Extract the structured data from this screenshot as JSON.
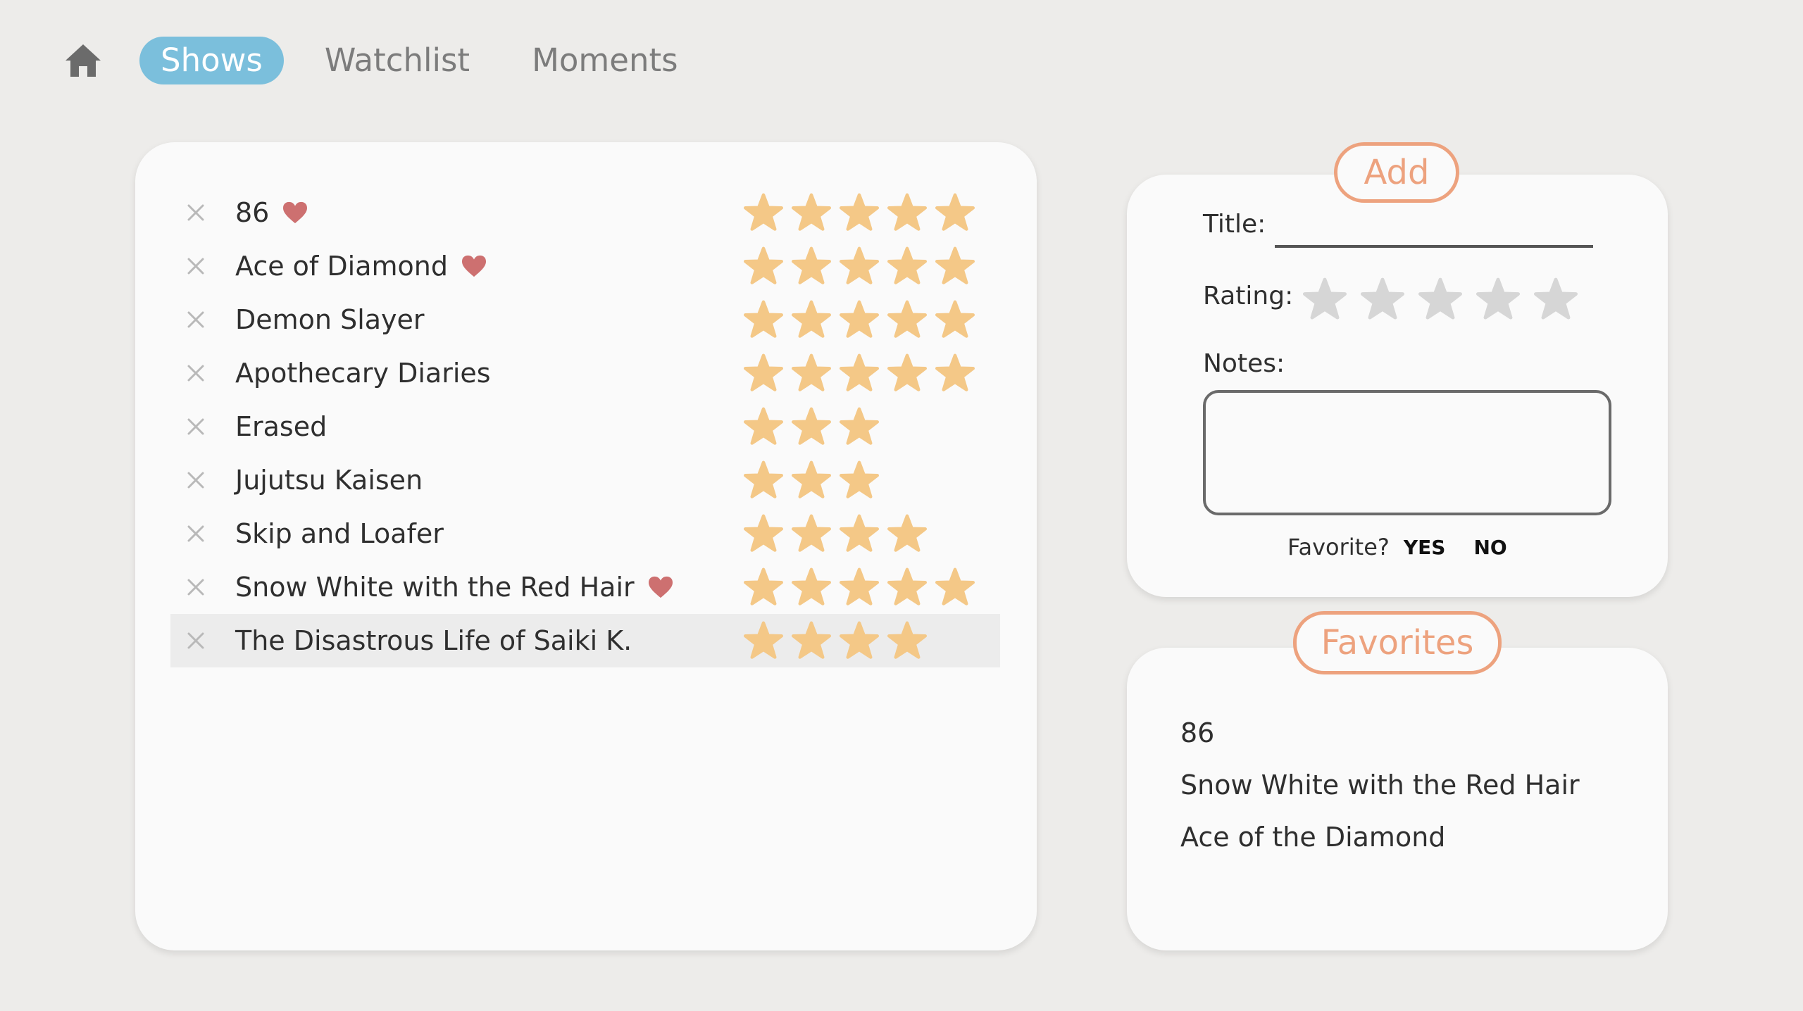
{
  "nav": {
    "home_icon": "home-icon",
    "tabs": [
      {
        "label": "Shows",
        "active": true
      },
      {
        "label": "Watchlist",
        "active": false
      },
      {
        "label": "Moments",
        "active": false
      }
    ]
  },
  "colors": {
    "accent_blue": "#7bbfdc",
    "accent_orange": "#eda27e",
    "star_filled": "#f4c887",
    "star_empty": "#d6d6d6",
    "heart": "#cd7070"
  },
  "shows": [
    {
      "title": "86",
      "favorite": true,
      "rating": 5
    },
    {
      "title": "Ace of Diamond",
      "favorite": true,
      "rating": 5
    },
    {
      "title": "Demon Slayer",
      "favorite": false,
      "rating": 5
    },
    {
      "title": "Apothecary Diaries",
      "favorite": false,
      "rating": 5
    },
    {
      "title": "Erased",
      "favorite": false,
      "rating": 3
    },
    {
      "title": "Jujutsu Kaisen",
      "favorite": false,
      "rating": 3
    },
    {
      "title": "Skip and Loafer",
      "favorite": false,
      "rating": 4
    },
    {
      "title": "Snow White with the Red Hair",
      "favorite": true,
      "rating": 5
    },
    {
      "title": "The Disastrous Life of Saiki K.",
      "favorite": false,
      "rating": 4
    }
  ],
  "add_form": {
    "heading": "Add",
    "title_label": "Title:",
    "title_value": "",
    "rating_label": "Rating:",
    "rating_value": 0,
    "rating_max": 5,
    "notes_label": "Notes:",
    "notes_value": "",
    "favorite_label": "Favorite?",
    "yes_label": "YES",
    "no_label": "NO"
  },
  "favorites": {
    "heading": "Favorites",
    "items": [
      "86",
      "Snow White with the Red Hair",
      "Ace of the Diamond"
    ]
  }
}
